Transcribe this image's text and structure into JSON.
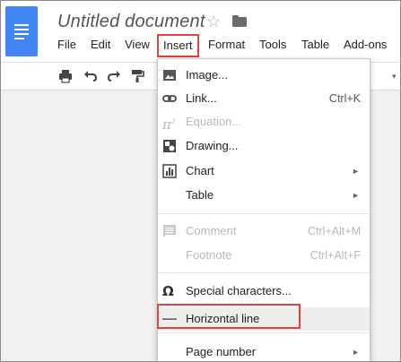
{
  "app": {
    "title": "Untitled document",
    "accent": "#4285f4",
    "highlight_color": "#e0453a"
  },
  "icons": {
    "star": "star-icon",
    "folder": "folder-icon",
    "logo": "docs-logo-icon"
  },
  "menubar": {
    "items": [
      "File",
      "Edit",
      "View",
      "Insert",
      "Format",
      "Tools",
      "Table",
      "Add-ons"
    ],
    "active": "Insert"
  },
  "toolbar": {
    "icons": [
      "print-icon",
      "undo-icon",
      "redo-icon",
      "paint-format-icon"
    ]
  },
  "insert_menu": {
    "items": [
      {
        "label": "Image...",
        "icon": "image-icon",
        "shortcut": "",
        "submenu": false,
        "disabled": false
      },
      {
        "label": "Link...",
        "icon": "link-icon",
        "shortcut": "Ctrl+K",
        "submenu": false,
        "disabled": false
      },
      {
        "label": "Equation...",
        "icon": "equation-icon",
        "shortcut": "",
        "submenu": false,
        "disabled": true
      },
      {
        "label": "Drawing...",
        "icon": "drawing-icon",
        "shortcut": "",
        "submenu": false,
        "disabled": false
      },
      {
        "label": "Chart",
        "icon": "chart-icon",
        "shortcut": "",
        "submenu": true,
        "disabled": false
      },
      {
        "label": "Table",
        "icon": "",
        "shortcut": "",
        "submenu": true,
        "disabled": false
      },
      {
        "label": "Comment",
        "icon": "comment-icon",
        "shortcut": "Ctrl+Alt+M",
        "submenu": false,
        "disabled": true
      },
      {
        "label": "Footnote",
        "icon": "",
        "shortcut": "Ctrl+Alt+F",
        "submenu": false,
        "disabled": true
      },
      {
        "label": "Special characters...",
        "icon": "omega-icon",
        "shortcut": "",
        "submenu": false,
        "disabled": false
      },
      {
        "label": "Horizontal line",
        "icon": "horizontal-line-icon",
        "shortcut": "",
        "submenu": false,
        "disabled": false,
        "highlighted": true
      },
      {
        "label": "Page number",
        "icon": "",
        "shortcut": "",
        "submenu": true,
        "disabled": false
      }
    ]
  }
}
